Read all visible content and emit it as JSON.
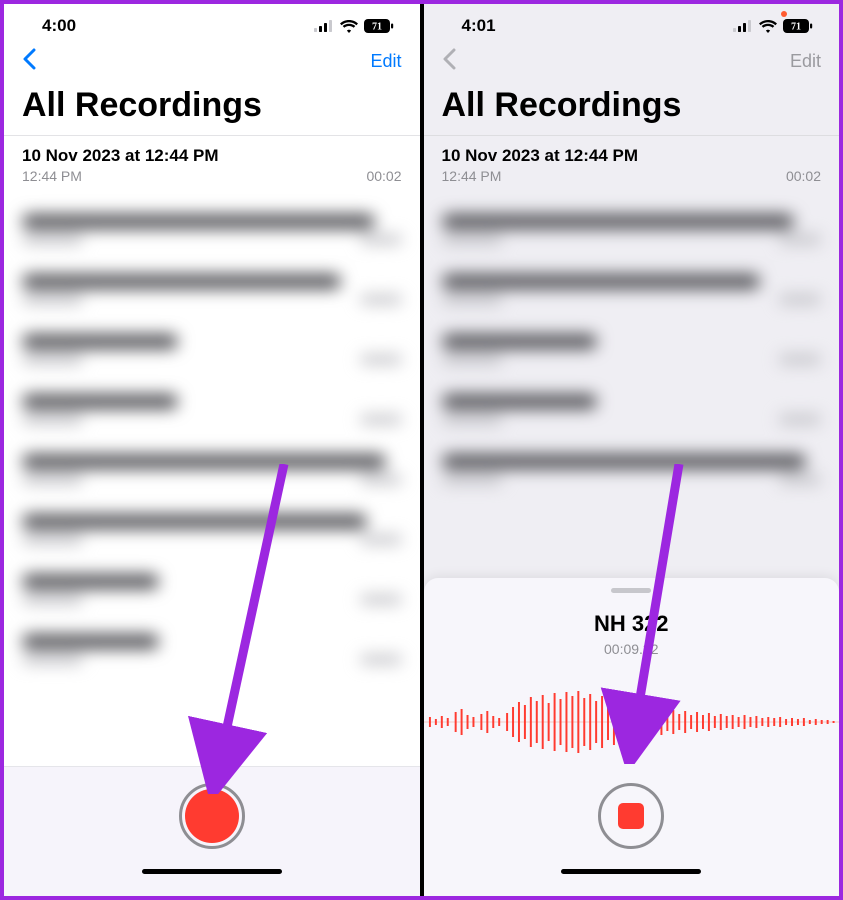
{
  "left": {
    "status": {
      "time": "4:00",
      "battery": "71"
    },
    "nav": {
      "edit": "Edit"
    },
    "title": "All Recordings",
    "firstRow": {
      "title": "10 Nov 2023 at 12:44 PM",
      "subLeft": "12:44 PM",
      "subRight": "00:02"
    }
  },
  "right": {
    "status": {
      "time": "4:01",
      "battery": "71"
    },
    "nav": {
      "edit": "Edit"
    },
    "title": "All Recordings",
    "firstRow": {
      "title": "10 Nov 2023 at 12:44 PM",
      "subLeft": "12:44 PM",
      "subRight": "00:02"
    },
    "recording": {
      "name": "NH 322",
      "elapsed": "00:09.32"
    }
  }
}
